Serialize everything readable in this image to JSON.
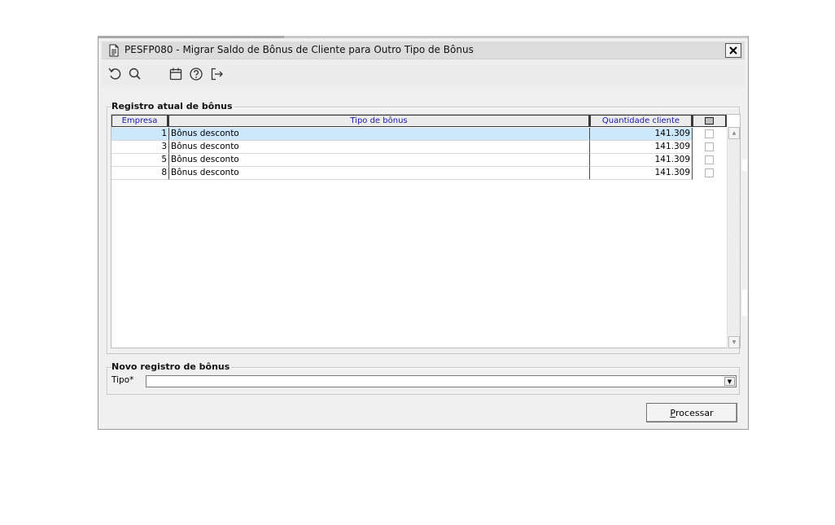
{
  "window": {
    "title": "PESFP080 - Migrar Saldo de Bônus de Cliente para Outro Tipo de Bônus",
    "close_icon": "close-icon"
  },
  "toolbar": {
    "buttons": [
      {
        "name": "undo-icon",
        "tooltip": ""
      },
      {
        "name": "search-icon",
        "tooltip": ""
      },
      {
        "name": "calendar-icon",
        "tooltip": ""
      },
      {
        "name": "help-icon",
        "tooltip": ""
      },
      {
        "name": "exit-icon",
        "tooltip": ""
      }
    ]
  },
  "current_group": {
    "legend": "Registro atual de bônus",
    "columns": {
      "empresa": "Empresa",
      "tipo": "Tipo de bônus",
      "quantidade": "Quantidade cliente"
    },
    "rows": [
      {
        "empresa": "1",
        "tipo": "Bônus desconto",
        "quantidade": "141.309",
        "checked": false
      },
      {
        "empresa": "3",
        "tipo": "Bônus desconto",
        "quantidade": "141.309",
        "checked": false
      },
      {
        "empresa": "5",
        "tipo": "Bônus desconto",
        "quantidade": "141.309",
        "checked": false
      },
      {
        "empresa": "8",
        "tipo": "Bônus desconto",
        "quantidade": "141.309",
        "checked": false
      }
    ],
    "selected_row": 0
  },
  "new_group": {
    "legend": "Novo registro de bônus",
    "tipo_label": "Tipo*",
    "tipo_value": ""
  },
  "actions": {
    "process_label": "Processar",
    "process_accesskey": "P",
    "process_rest": "rocessar"
  },
  "colors": {
    "selection": "#cde8fb",
    "header_text": "#1a1aa6",
    "window_bg": "#f0f0f0"
  }
}
